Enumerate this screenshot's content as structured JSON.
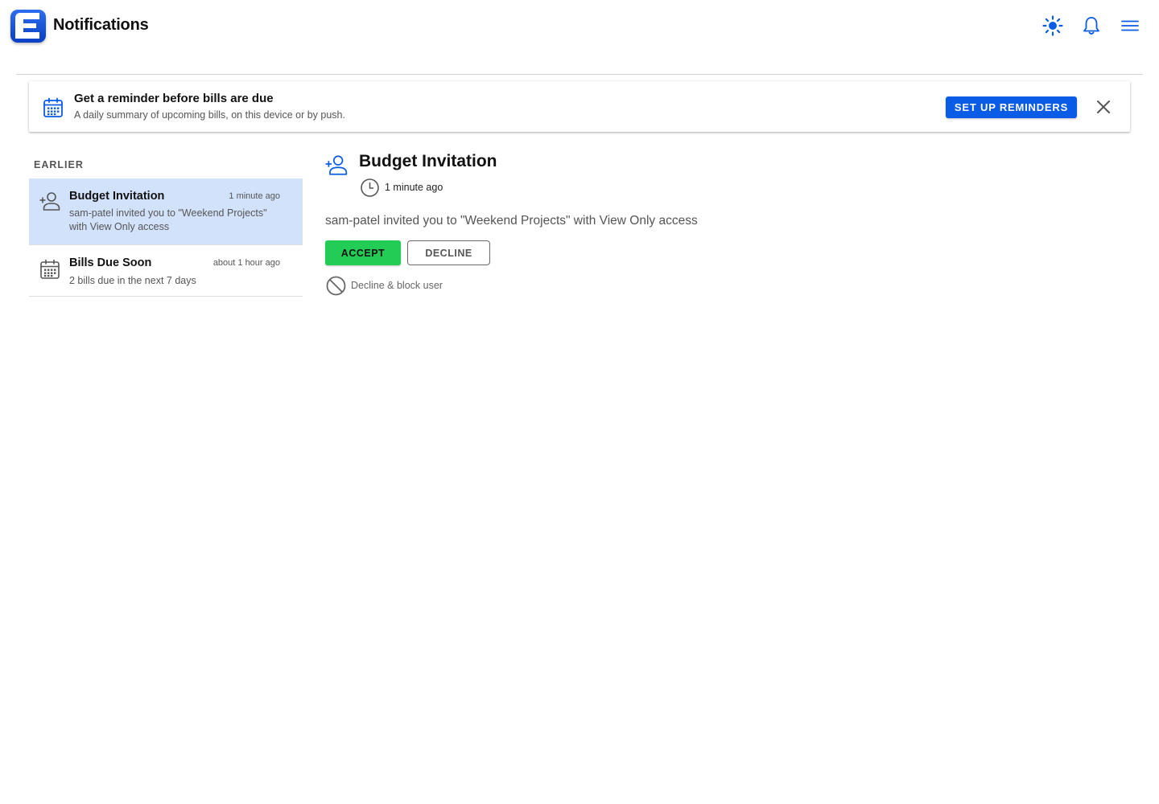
{
  "header": {
    "title": "Notifications",
    "logo_letter": "E",
    "icons": [
      "sun-icon",
      "bell-icon",
      "menu-icon"
    ],
    "accent_color": "#0a5ce6"
  },
  "banner": {
    "title": "Get a reminder before bills are due",
    "subtitle": "A daily summary of upcoming bills, on this device or by push.",
    "button_label": "SET UP REMINDERS",
    "icon": "calendar-icon"
  },
  "list": {
    "section_label": "EARLIER",
    "items": [
      {
        "title": "Budget Invitation",
        "time": "1 minute ago",
        "body": "sam-patel invited you to \"Weekend Projects\" with View Only access",
        "icon": "add-person-icon",
        "selected": true
      },
      {
        "title": "Bills Due Soon",
        "time": "about 1 hour ago",
        "body": "2 bills due in the next 7 days",
        "icon": "calendar-icon",
        "selected": false
      }
    ]
  },
  "detail": {
    "title": "Budget Invitation",
    "time": "1 minute ago",
    "message": "sam-patel invited you to \"Weekend Projects\" with View Only access",
    "accept_label": "ACCEPT",
    "decline_label": "DECLINE",
    "block_label": "Decline & block user"
  },
  "colors": {
    "selected_row": "#d3e2fb",
    "accept_green": "#22cc55",
    "primary_blue": "#0a5ce6"
  }
}
